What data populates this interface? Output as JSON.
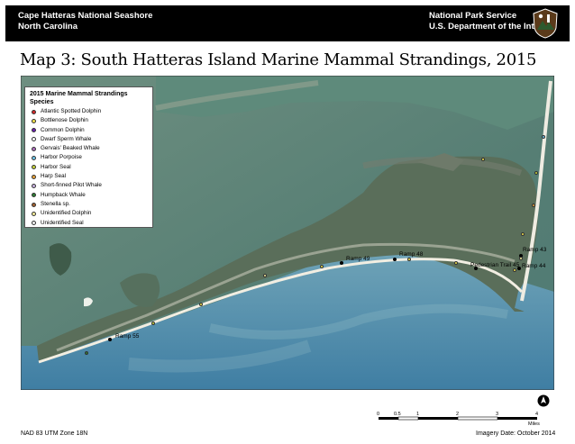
{
  "header": {
    "park_name": "Cape Hatteras National Seashore",
    "state": "North Carolina",
    "agency": "National Park Service",
    "department": "U.S. Department of the Interior",
    "logo_icon": "nps-arrowhead-icon"
  },
  "title": "Map 3:  South Hatteras Island Marine Mammal Strandings, 2015",
  "legend": {
    "title": "2015 Marine Mammal Strandings",
    "subtitle": "Species",
    "species": [
      {
        "name": "Atlantic Spotted Dolphin",
        "color": "#d62728"
      },
      {
        "name": "Bottlenose Dolphin",
        "color": "#f2e34c"
      },
      {
        "name": "Common Dolphin",
        "color": "#6a1fb0"
      },
      {
        "name": "Dwarf Sperm Whale",
        "color": "#ffffff"
      },
      {
        "name": "Gervais' Beaked Whale",
        "color": "#b070c0"
      },
      {
        "name": "Harbor Porpoise",
        "color": "#6ec6e8"
      },
      {
        "name": "Harbor Seal",
        "color": "#c7d33a"
      },
      {
        "name": "Harp Seal",
        "color": "#e8a23a"
      },
      {
        "name": "Short-finned Pilot Whale",
        "color": "#c9b3e0"
      },
      {
        "name": "Humpback Whale",
        "color": "#2e7d32"
      },
      {
        "name": "Stenella sp.",
        "color": "#a0612e"
      },
      {
        "name": "Unidentified Dolphin",
        "color": "#f5ee9a"
      },
      {
        "name": "Unidentified Seal",
        "color": "#f3f3f3"
      }
    ]
  },
  "ramps": {
    "ramp55": "Ramp 55",
    "ramp49": "Ramp 49",
    "ramp48": "Ramp 48",
    "pedestrian45": "Pedestrian Trail 45",
    "ramp43": "Ramp 43",
    "ramp44": "Ramp 44"
  },
  "scale": {
    "ticks": [
      "0",
      "0.5",
      "1",
      "2",
      "3",
      "4"
    ],
    "unit": "Miles"
  },
  "north_icon": "north-arrow-icon",
  "footer": {
    "projection": "NAD 83 UTM Zone 18N",
    "imagery": "Imagery Date:  October 2014"
  }
}
